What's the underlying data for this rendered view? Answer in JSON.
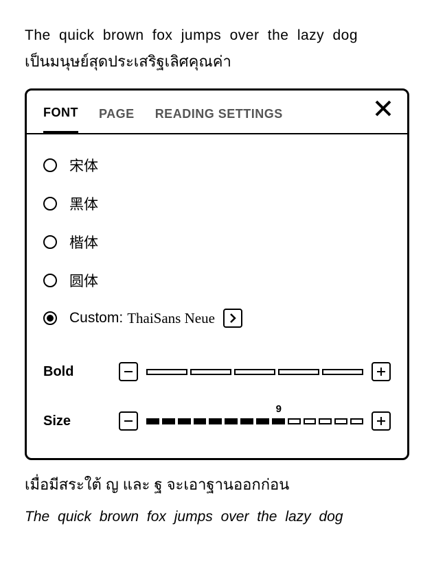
{
  "preview": {
    "line1": "The quick brown fox jumps over the lazy dog",
    "line2": "เป็นมนุษย์สุดประเสริฐเลิศคุณค่า"
  },
  "tabs": {
    "font": "FONT",
    "page": "PAGE",
    "reading": "READING SETTINGS"
  },
  "fonts": {
    "opt0": "宋体",
    "opt1": "黑体",
    "opt2": "楷体",
    "opt3": "圆体",
    "custom_label": "Custom:",
    "custom_value": "ThaiSans Neue"
  },
  "sliders": {
    "bold_label": "Bold",
    "size_label": "Size",
    "size_value": "9"
  },
  "below": {
    "line1": "เมื่อมีสระใต้ ญ และ ฐ จะเอาฐานออกก่อน",
    "line2": "The quick brown fox jumps over the lazy dog"
  }
}
